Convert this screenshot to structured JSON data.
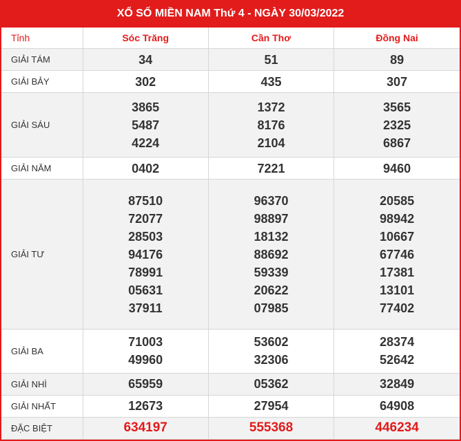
{
  "title": "XỔ SỐ MIỀN NAM Thứ 4 - NGÀY 30/03/2022",
  "header_label": "Tỉnh",
  "provinces": [
    "Sóc Trăng",
    "Cần Thơ",
    "Đồng Nai"
  ],
  "prizes": [
    {
      "label": "GIẢI TÁM",
      "values": [
        [
          "34"
        ],
        [
          "51"
        ],
        [
          "89"
        ]
      ]
    },
    {
      "label": "GIẢI BẢY",
      "values": [
        [
          "302"
        ],
        [
          "435"
        ],
        [
          "307"
        ]
      ]
    },
    {
      "label": "GIẢI SÁU",
      "values": [
        [
          "3865",
          "5487",
          "4224"
        ],
        [
          "1372",
          "8176",
          "2104"
        ],
        [
          "3565",
          "2325",
          "6867"
        ]
      ]
    },
    {
      "label": "GIẢI NĂM",
      "values": [
        [
          "0402"
        ],
        [
          "7221"
        ],
        [
          "9460"
        ]
      ]
    },
    {
      "label": "GIẢI TƯ",
      "values": [
        [
          "87510",
          "72077",
          "28503",
          "94176",
          "78991",
          "05631",
          "37911"
        ],
        [
          "96370",
          "98897",
          "18132",
          "88692",
          "59339",
          "20622",
          "07985"
        ],
        [
          "20585",
          "98942",
          "10667",
          "67746",
          "17381",
          "13101",
          "77402"
        ]
      ]
    },
    {
      "label": "GIẢI BA",
      "values": [
        [
          "71003",
          "49960"
        ],
        [
          "53602",
          "32306"
        ],
        [
          "28374",
          "52642"
        ]
      ]
    },
    {
      "label": "GIẢI NHÌ",
      "values": [
        [
          "65959"
        ],
        [
          "05362"
        ],
        [
          "32849"
        ]
      ]
    },
    {
      "label": "GIẢI NHẤT",
      "values": [
        [
          "12673"
        ],
        [
          "27954"
        ],
        [
          "64908"
        ]
      ]
    },
    {
      "label": "ĐẶC BIỆT",
      "values": [
        [
          "634197"
        ],
        [
          "555368"
        ],
        [
          "446234"
        ]
      ],
      "special": true
    }
  ],
  "colors": {
    "accent": "#e21b1b",
    "row_alt": "#f2f2f2",
    "text": "#333333"
  }
}
